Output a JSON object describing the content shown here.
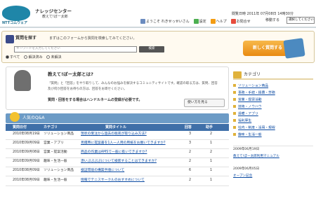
{
  "header": {
    "logo_text": "NTTコムウェア",
    "site_title": "ナレッジセンター",
    "site_subtitle": "教えて!ぼー太郎",
    "date_text": "閲覧日時 2011年 07月08日 14時30分",
    "links": [
      {
        "label": "ようこそ れきせっせいさん",
        "icon": "user-icon",
        "color": "#6b8cbf"
      },
      {
        "label": "設定",
        "icon": "gear-icon",
        "color": "#4caf50"
      },
      {
        "label": "ヘルプ",
        "icon": "help-icon",
        "color": "#f39c12"
      },
      {
        "label": "お問合せ",
        "icon": "mail-icon",
        "color": "#e74c3c"
      }
    ],
    "move_label": "移動する",
    "select_placeholder": "選択してください"
  },
  "search": {
    "title": "質問を探す",
    "description": "まずはこのフォームから質問を検索してみてください。",
    "input_placeholder": "キーワードを入力してください",
    "button_label": "検索",
    "radios": [
      {
        "label": "すべて",
        "checked": true
      },
      {
        "label": "解決済み",
        "checked": false
      },
      {
        "label": "未解決",
        "checked": false
      }
    ],
    "ask_button_label": "新しく質問する"
  },
  "main": {
    "title": "教えて!ぼー太郎とは?",
    "desc_line1": "「質問」と「回答」をやり取りして、みんなのお悩みを解決するコミュニティサイトです。確認の取る方は、質問、回答",
    "desc_line2": "及び何か回答をお待ちの方は、回答をお寄せください。",
    "notice": "質問・回答をする場合はハンドルネームの登録が必要です。",
    "how_button": "使い方を見る"
  },
  "popular": {
    "title": "人気のQ&A",
    "headers": [
      "質問日付",
      "カテゴリ",
      "質問タイトル",
      "回答",
      "助手"
    ],
    "rows": [
      {
        "date": "2010年08月19日",
        "category": "ソリューション商品",
        "title": "現状の受注から過去の販売が取り込み方法?",
        "answers": "3",
        "helpers": "2"
      },
      {
        "date": "2010年09月09日",
        "category": "営業・アプリ",
        "title": "見積時に提案書を1人一人用の用紙をお願いできますか?",
        "answers": "3",
        "helpers": "1"
      },
      {
        "date": "2010年09月08日",
        "category": "営業・提案活動",
        "title": "商品の作業はAMSで一般に扱いできますか?",
        "answers": "2",
        "helpers": "2"
      },
      {
        "date": "2010年09月09日",
        "category": "趣味・生活一般",
        "title": "添いぷぷぷぷについて検索することはできますか?",
        "answers": "2",
        "helpers": "1"
      },
      {
        "date": "2010年08月09日",
        "category": "ソリューション商品",
        "title": "検証環境の構築手順について",
        "answers": "6",
        "helpers": "1"
      },
      {
        "date": "2010年08月09日",
        "category": "趣味・生活一般",
        "title": "情報でテニスサークルのおすすめについて",
        "answers": "2",
        "helpers": "1"
      }
    ]
  },
  "sidebar": {
    "category_title": "カテゴリ",
    "categories": [
      "ソリューション商品",
      "事務・手続・経費・労務",
      "営業・提案活動",
      "技術・ノウハウ",
      "設備・アプリ",
      "福利厚生",
      "社内・制度・活用・規程",
      "趣味・生活一般"
    ],
    "news": [
      {
        "date": "2009年06月19日",
        "text": "教えて!ぼー太郎利用マニュアル"
      },
      {
        "date": "2009年06月05日",
        "text": "オープン記念"
      }
    ]
  }
}
